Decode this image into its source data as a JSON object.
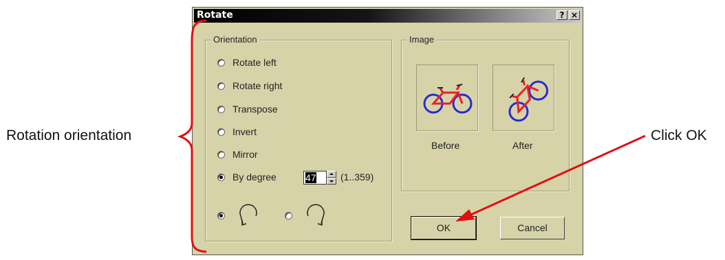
{
  "callouts": {
    "left": "Rotation orientation",
    "right": "Click OK"
  },
  "dialog": {
    "title": "Rotate",
    "help_button": "?",
    "close_button": "×",
    "orientation": {
      "legend": "Orientation",
      "options": [
        "Rotate left",
        "Rotate right",
        "Transpose",
        "Invert",
        "Mirror",
        "By degree"
      ],
      "selected": "By degree",
      "degree_value": "47",
      "degree_range": "(1..359)",
      "direction_selected": "counterclockwise"
    },
    "image": {
      "legend": "Image",
      "before_label": "Before",
      "after_label": "After"
    },
    "buttons": {
      "ok": "OK",
      "cancel": "Cancel"
    }
  },
  "colors": {
    "dialog_bg": "#d6d3a9",
    "annotation": "#e01010",
    "bike_frame": "#e8202a",
    "bike_wheels": "#2a2ad0"
  },
  "icons": [
    "help-icon",
    "close-icon",
    "rotate-ccw-icon",
    "rotate-cw-icon",
    "bike-before-icon",
    "bike-after-icon"
  ]
}
